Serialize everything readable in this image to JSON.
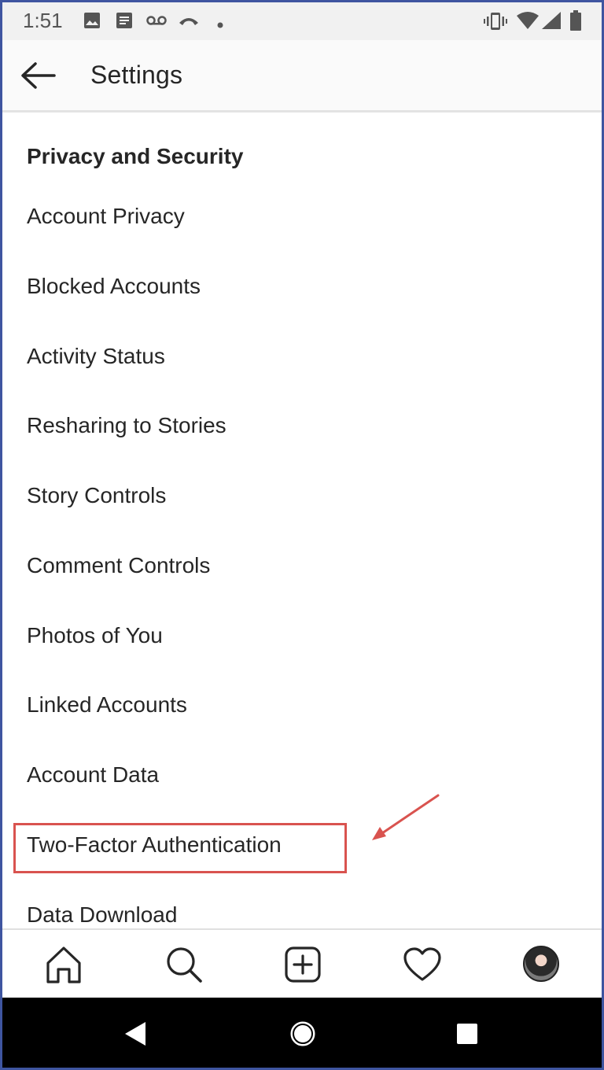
{
  "status_bar": {
    "time": "1:51",
    "left_icons": [
      "image-icon",
      "message-icon",
      "voicemail-icon",
      "missed-call-icon",
      "dot-icon"
    ],
    "right_icons": [
      "vibrate-icon",
      "wifi-icon",
      "signal-icon",
      "battery-icon"
    ]
  },
  "header": {
    "title": "Settings",
    "back_icon": "arrow-left-icon"
  },
  "section": {
    "title": "Privacy and Security",
    "items": [
      "Account Privacy",
      "Blocked Accounts",
      "Activity Status",
      "Resharing to Stories",
      "Story Controls",
      "Comment Controls",
      "Photos of You",
      "Linked Accounts",
      "Account Data",
      "Two-Factor Authentication",
      "Data Download"
    ],
    "highlighted_item": "Two-Factor Authentication"
  },
  "annotation": {
    "highlight_color": "#d9534f"
  },
  "tab_bar": {
    "tabs": [
      "home-icon",
      "search-icon",
      "add-post-icon",
      "heart-icon",
      "profile-avatar"
    ]
  },
  "android_nav": {
    "buttons": [
      "back-triangle-icon",
      "home-circle-icon",
      "recents-square-icon"
    ]
  }
}
